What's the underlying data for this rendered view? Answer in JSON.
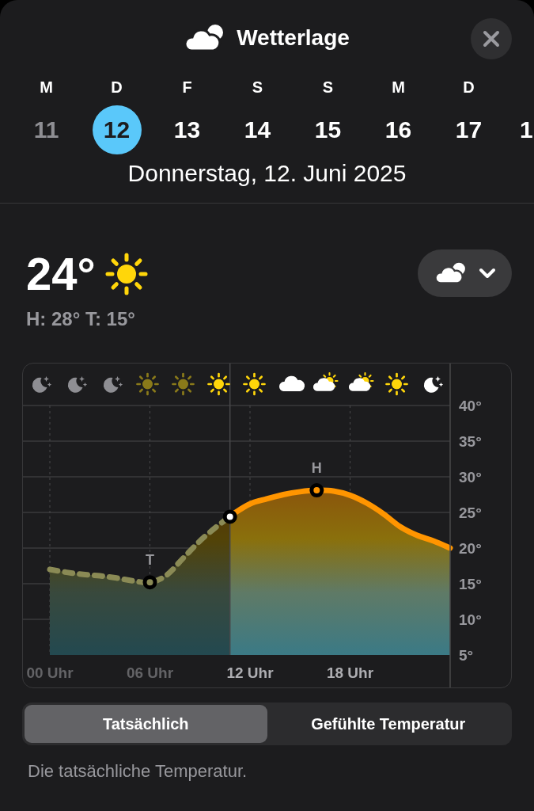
{
  "header": {
    "title": "Wetterlage"
  },
  "days": [
    {
      "weekday": "M",
      "day": "11",
      "selected": false,
      "past": true
    },
    {
      "weekday": "D",
      "day": "12",
      "selected": true,
      "past": false
    },
    {
      "weekday": "F",
      "day": "13",
      "selected": false,
      "past": false
    },
    {
      "weekday": "S",
      "day": "14",
      "selected": false,
      "past": false
    },
    {
      "weekday": "S",
      "day": "15",
      "selected": false,
      "past": false
    },
    {
      "weekday": "M",
      "day": "16",
      "selected": false,
      "past": false
    },
    {
      "weekday": "D",
      "day": "17",
      "selected": false,
      "past": false
    },
    {
      "day": "1",
      "selected": false,
      "past": false
    }
  ],
  "date_label": "Donnerstag, 12. Juni 2025",
  "current": {
    "temperature": "24°",
    "high_low": "H: 28° T: 15°"
  },
  "chart": {
    "hourly_icons": [
      {
        "kind": "moon",
        "past": true
      },
      {
        "kind": "moon",
        "past": true
      },
      {
        "kind": "moon",
        "past": true
      },
      {
        "kind": "sun",
        "past": true
      },
      {
        "kind": "sun",
        "past": true
      },
      {
        "kind": "sun",
        "past": false
      },
      {
        "kind": "sun",
        "past": false
      },
      {
        "kind": "cloud",
        "past": false
      },
      {
        "kind": "partly",
        "past": false
      },
      {
        "kind": "partly",
        "past": false
      },
      {
        "kind": "sun",
        "past": false
      },
      {
        "kind": "moon",
        "past": false
      }
    ],
    "chart_data": {
      "type": "area",
      "x": [
        0,
        1,
        2,
        3,
        4,
        5,
        6,
        7,
        8,
        9,
        10,
        10.8,
        11,
        12,
        13,
        14,
        15,
        16,
        17,
        18,
        19,
        20,
        21,
        22,
        23,
        24
      ],
      "series": [
        {
          "color": "#8a8a55",
          "values": [
            17,
            16.6,
            16.3,
            16.1,
            15.8,
            15.4,
            15.2,
            16.2,
            18.6,
            21,
            23,
            24.4,
            null,
            null,
            null,
            null,
            null,
            null,
            null,
            null,
            null,
            null,
            null,
            null,
            null,
            null
          ]
        },
        {
          "color": "#ff9500",
          "values": [
            null,
            null,
            null,
            null,
            null,
            null,
            null,
            null,
            null,
            null,
            null,
            24.4,
            24.8,
            26.2,
            26.9,
            27.5,
            27.9,
            28.1,
            28,
            27.4,
            26.3,
            24.8,
            23,
            21.8,
            21,
            20
          ]
        }
      ],
      "xlim": [
        0,
        24
      ],
      "ylim": [
        5,
        40
      ],
      "grid": true,
      "ref_lines": [
        {
          "axis": "x",
          "value": 10.8
        }
      ],
      "xticks": [
        {
          "value": 0,
          "label": "00 Uhr"
        },
        {
          "value": 6,
          "label": "06 Uhr"
        },
        {
          "value": 12,
          "label": "12 Uhr"
        },
        {
          "value": 18,
          "label": "18 Uhr"
        }
      ],
      "yticks": [
        {
          "value": 40,
          "label": "40°"
        },
        {
          "value": 35,
          "label": "35°"
        },
        {
          "value": 30,
          "label": "30°"
        },
        {
          "value": 25,
          "label": "25°"
        },
        {
          "value": 20,
          "label": "20°"
        },
        {
          "value": 15,
          "label": "15°"
        },
        {
          "value": 10,
          "label": "10°"
        },
        {
          "value": 5,
          "label": "5°"
        }
      ],
      "annotations": [
        {
          "text": "T",
          "x": 6,
          "y": 15.2
        },
        {
          "text": "H",
          "x": 16,
          "y": 28.1
        }
      ]
    }
  },
  "segments": [
    {
      "label": "Tatsächlich",
      "selected": true
    },
    {
      "label": "Gefühlte Temperatur",
      "selected": false
    }
  ],
  "description": "Die tatsächliche Temperatur."
}
